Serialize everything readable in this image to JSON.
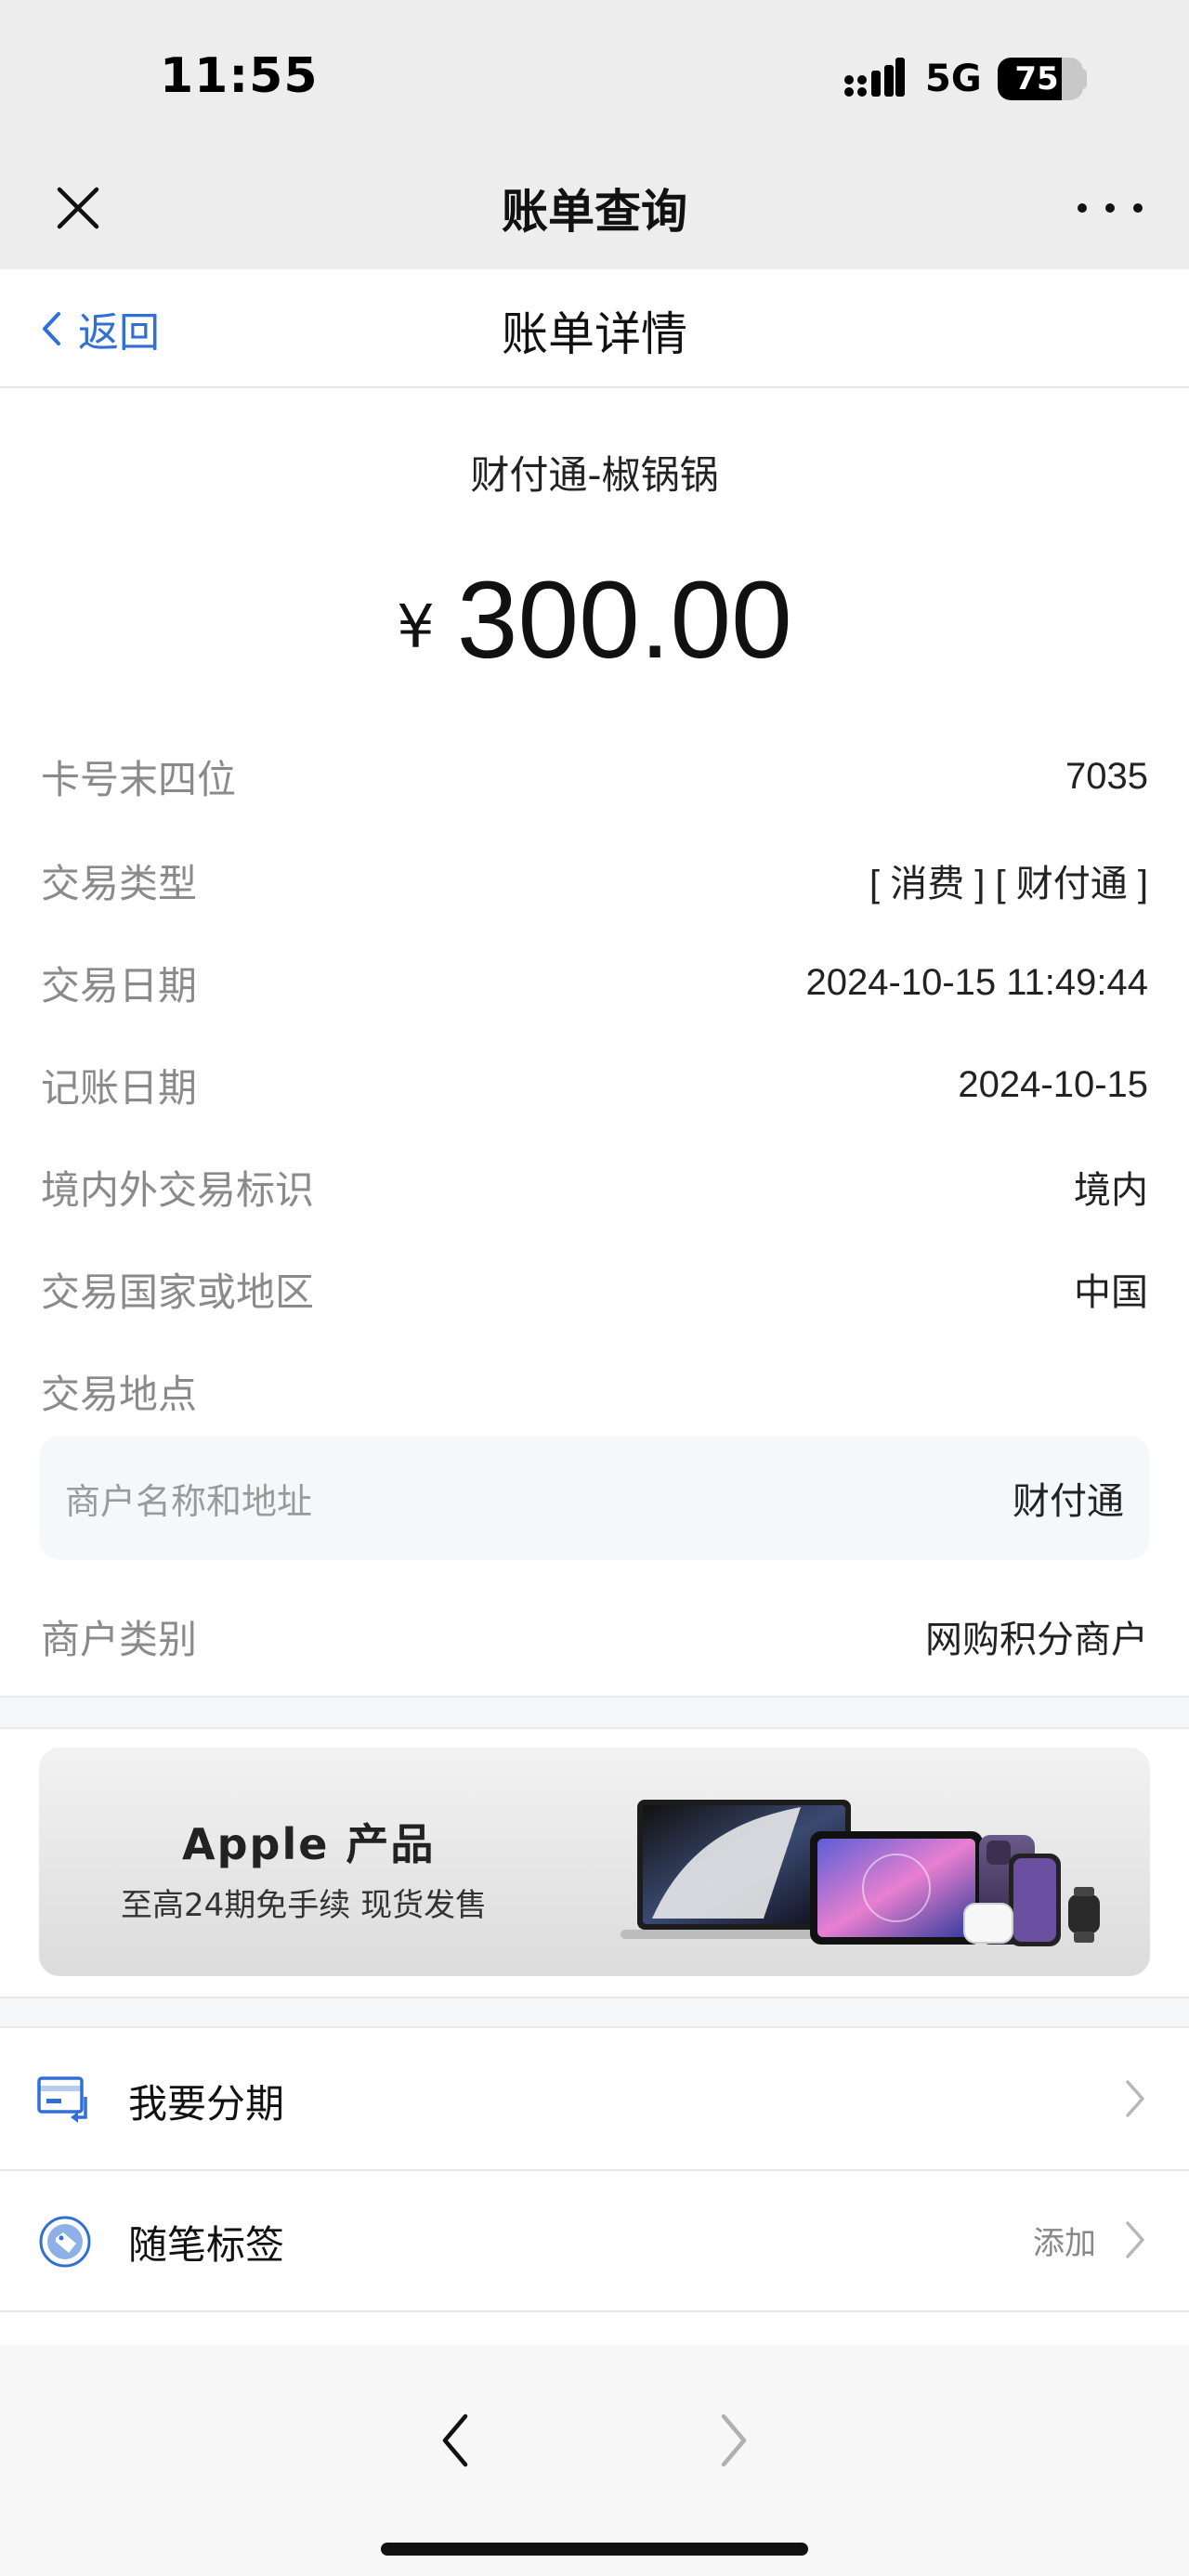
{
  "status_bar": {
    "time": "11:55",
    "network": "5G",
    "battery": "75",
    "battery_level": 0.75
  },
  "wechat_bar": {
    "title": "账单查询",
    "close_icon": "close-icon",
    "more_icon": "more-dots-icon"
  },
  "nav": {
    "back_label": "返回",
    "title": "账单详情"
  },
  "header": {
    "merchant": "财付通-椒锅锅",
    "currency": "¥",
    "amount": "300.00"
  },
  "details": {
    "card_last4": {
      "label": "卡号末四位",
      "value": "7035"
    },
    "txn_type": {
      "label": "交易类型",
      "value": "[ 消费 ] [ 财付通 ]"
    },
    "txn_date": {
      "label": "交易日期",
      "value": "2024-10-15 11:49:44"
    },
    "post_date": {
      "label": "记账日期",
      "value": "2024-10-15"
    },
    "domestic": {
      "label": "境内外交易标识",
      "value": "境内"
    },
    "country": {
      "label": "交易国家或地区",
      "value": "中国"
    },
    "location": {
      "label": "交易地点"
    },
    "merchant_addr": {
      "label": "商户名称和地址",
      "value": "财付通"
    },
    "merchant_cat": {
      "label": "商户类别",
      "value": "网购积分商户"
    }
  },
  "banner": {
    "title": "Apple 产品",
    "subtitle": "至高24期免手续 现货发售"
  },
  "actions": {
    "installment": {
      "label": "我要分期",
      "icon": "installment-card-icon"
    },
    "tag": {
      "label": "随笔标签",
      "extra": "添加",
      "icon": "tag-icon"
    }
  },
  "colors": {
    "accent": "#2f6fd6",
    "label_gray": "#8a8a8a",
    "top_bar": "#ededed"
  }
}
